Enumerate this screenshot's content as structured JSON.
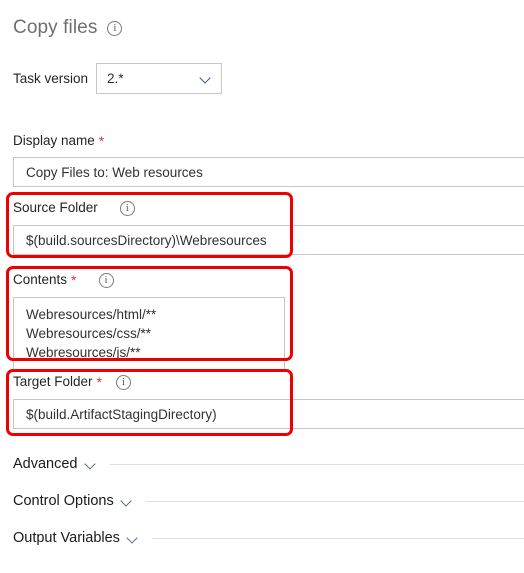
{
  "header": {
    "title": "Copy files",
    "info_icon": "info-icon"
  },
  "task_version": {
    "label": "Task version",
    "value": "2.*",
    "chevron_icon": "chevron-down-icon"
  },
  "fields": {
    "display_name": {
      "label": "Display name",
      "required": "*",
      "value": "Copy Files to: Web resources"
    },
    "source_folder": {
      "label": "Source Folder",
      "required": "",
      "info_icon": "info-icon",
      "value": "$(build.sourcesDirectory)\\Webresources",
      "highlighted": true
    },
    "contents": {
      "label": "Contents",
      "required": "*",
      "info_icon": "info-icon",
      "lines": [
        "Webresources/html/**",
        "Webresources/css/**",
        "Webresources/js/**"
      ],
      "highlighted": true
    },
    "target_folder": {
      "label": "Target Folder",
      "required": "*",
      "info_icon": "info-icon",
      "value": "$(build.ArtifactStagingDirectory)",
      "highlighted": true
    }
  },
  "sections": [
    {
      "label": "Advanced",
      "chevron_icon": "chevron-down-icon"
    },
    {
      "label": "Control Options",
      "chevron_icon": "chevron-down-icon"
    },
    {
      "label": "Output Variables",
      "chevron_icon": "chevron-down-icon"
    }
  ],
  "colors": {
    "highlight": "#ef0000",
    "required_asterisk": "#d13438",
    "title": "#6f6f6f",
    "border": "#c8c6c4"
  }
}
